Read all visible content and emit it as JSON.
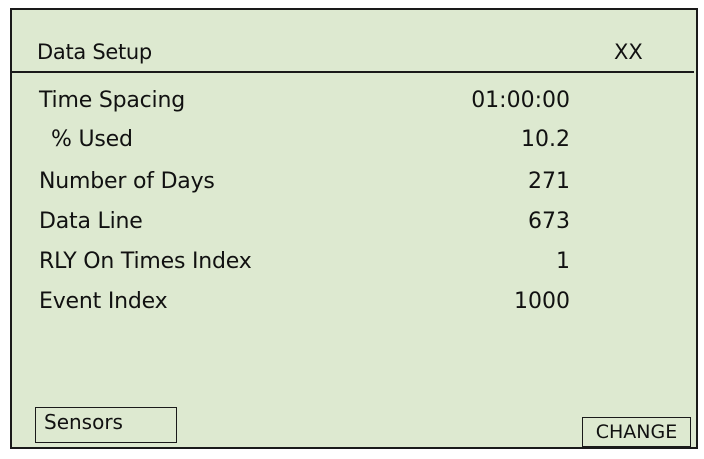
{
  "header": {
    "title": "Data Setup",
    "code": "XX"
  },
  "rows": [
    {
      "label": "Time Spacing",
      "value": "01:00:00"
    },
    {
      "label": "% Used",
      "value": "10.2"
    },
    {
      "label": "Number of Days",
      "value": "271"
    },
    {
      "label": "Data Line",
      "value": "673"
    },
    {
      "label": "RLY On Times Index",
      "value": "1"
    },
    {
      "label": "Event Index",
      "value": "1000"
    }
  ],
  "buttons": {
    "sensors_label": "Sensors",
    "change_label": "CHANGE"
  },
  "colors": {
    "screen_background": "#dde9d0",
    "border": "#1a1a1a",
    "text": "#111111"
  }
}
